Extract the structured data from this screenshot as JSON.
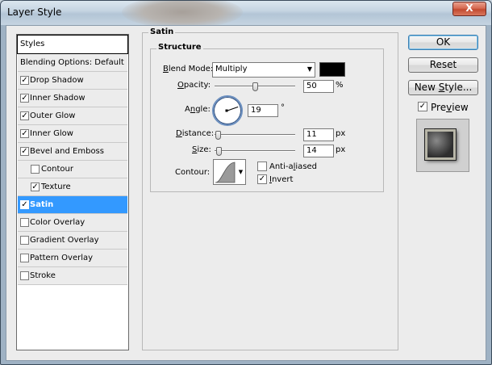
{
  "window": {
    "title": "Layer Style",
    "close_glyph": "X"
  },
  "styles_list": {
    "header": "Styles",
    "items": [
      {
        "label": "Blending Options: Default",
        "checkbox": false,
        "checked": false,
        "indent": false
      },
      {
        "label": "Drop Shadow",
        "checkbox": true,
        "checked": true,
        "indent": false
      },
      {
        "label": "Inner Shadow",
        "checkbox": true,
        "checked": true,
        "indent": false
      },
      {
        "label": "Outer Glow",
        "checkbox": true,
        "checked": true,
        "indent": false
      },
      {
        "label": "Inner Glow",
        "checkbox": true,
        "checked": true,
        "indent": false
      },
      {
        "label": "Bevel and Emboss",
        "checkbox": true,
        "checked": true,
        "indent": false
      },
      {
        "label": "Contour",
        "checkbox": true,
        "checked": false,
        "indent": true
      },
      {
        "label": "Texture",
        "checkbox": true,
        "checked": true,
        "indent": true
      },
      {
        "label": "Satin",
        "checkbox": true,
        "checked": true,
        "indent": false,
        "selected": true
      },
      {
        "label": "Color Overlay",
        "checkbox": true,
        "checked": false,
        "indent": false
      },
      {
        "label": "Gradient Overlay",
        "checkbox": true,
        "checked": false,
        "indent": false
      },
      {
        "label": "Pattern Overlay",
        "checkbox": true,
        "checked": false,
        "indent": false
      },
      {
        "label": "Stroke",
        "checkbox": true,
        "checked": false,
        "indent": false
      }
    ],
    "check_glyph": "✓"
  },
  "satin": {
    "group_title": "Satin",
    "structure_title": "Structure",
    "blend_mode": {
      "label_u": "B",
      "label_rest": "lend Mode:",
      "value": "Multiply",
      "color": "#000000"
    },
    "opacity": {
      "label_u": "O",
      "label_rest": "pacity:",
      "value": "50",
      "unit": "%",
      "level": 0.5
    },
    "angle": {
      "label_u": "n",
      "label_pre": "A",
      "label_rest": "gle:",
      "value": "19",
      "unit": "°"
    },
    "distance": {
      "label_u": "D",
      "label_rest": "istance:",
      "value": "11",
      "unit": "px",
      "level": 0.04
    },
    "size": {
      "label_u": "S",
      "label_rest": "ize:",
      "value": "14",
      "unit": "px",
      "level": 0.05
    },
    "contour": {
      "label": "Contour:"
    },
    "anti_aliased": {
      "pre": "Anti-a",
      "u": "l",
      "rest": "iased",
      "checked": false
    },
    "invert": {
      "u": "I",
      "rest": "nvert",
      "checked": true
    }
  },
  "buttons": {
    "ok": "OK",
    "reset": "Reset",
    "new_style_pre": "New ",
    "new_style_u": "S",
    "new_style_rest": "tyle...",
    "preview_pre": "Pre",
    "preview_u": "v",
    "preview_rest": "iew",
    "preview_checked": true
  }
}
